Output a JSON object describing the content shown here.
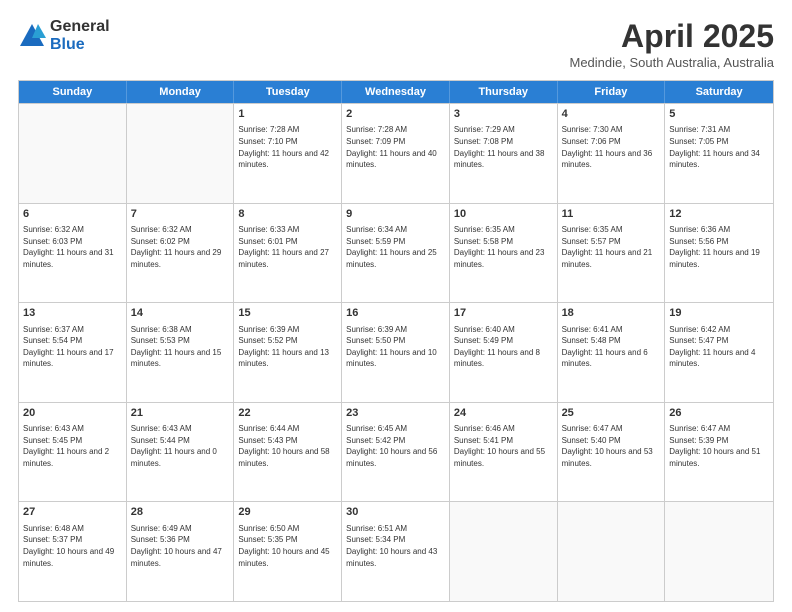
{
  "logo": {
    "general": "General",
    "blue": "Blue"
  },
  "header": {
    "month_year": "April 2025",
    "location": "Medindie, South Australia, Australia"
  },
  "days_of_week": [
    "Sunday",
    "Monday",
    "Tuesday",
    "Wednesday",
    "Thursday",
    "Friday",
    "Saturday"
  ],
  "rows": [
    [
      {
        "day": "",
        "info": ""
      },
      {
        "day": "",
        "info": ""
      },
      {
        "day": "1",
        "info": "Sunrise: 7:28 AM\nSunset: 7:10 PM\nDaylight: 11 hours and 42 minutes."
      },
      {
        "day": "2",
        "info": "Sunrise: 7:28 AM\nSunset: 7:09 PM\nDaylight: 11 hours and 40 minutes."
      },
      {
        "day": "3",
        "info": "Sunrise: 7:29 AM\nSunset: 7:08 PM\nDaylight: 11 hours and 38 minutes."
      },
      {
        "day": "4",
        "info": "Sunrise: 7:30 AM\nSunset: 7:06 PM\nDaylight: 11 hours and 36 minutes."
      },
      {
        "day": "5",
        "info": "Sunrise: 7:31 AM\nSunset: 7:05 PM\nDaylight: 11 hours and 34 minutes."
      }
    ],
    [
      {
        "day": "6",
        "info": "Sunrise: 6:32 AM\nSunset: 6:03 PM\nDaylight: 11 hours and 31 minutes."
      },
      {
        "day": "7",
        "info": "Sunrise: 6:32 AM\nSunset: 6:02 PM\nDaylight: 11 hours and 29 minutes."
      },
      {
        "day": "8",
        "info": "Sunrise: 6:33 AM\nSunset: 6:01 PM\nDaylight: 11 hours and 27 minutes."
      },
      {
        "day": "9",
        "info": "Sunrise: 6:34 AM\nSunset: 5:59 PM\nDaylight: 11 hours and 25 minutes."
      },
      {
        "day": "10",
        "info": "Sunrise: 6:35 AM\nSunset: 5:58 PM\nDaylight: 11 hours and 23 minutes."
      },
      {
        "day": "11",
        "info": "Sunrise: 6:35 AM\nSunset: 5:57 PM\nDaylight: 11 hours and 21 minutes."
      },
      {
        "day": "12",
        "info": "Sunrise: 6:36 AM\nSunset: 5:56 PM\nDaylight: 11 hours and 19 minutes."
      }
    ],
    [
      {
        "day": "13",
        "info": "Sunrise: 6:37 AM\nSunset: 5:54 PM\nDaylight: 11 hours and 17 minutes."
      },
      {
        "day": "14",
        "info": "Sunrise: 6:38 AM\nSunset: 5:53 PM\nDaylight: 11 hours and 15 minutes."
      },
      {
        "day": "15",
        "info": "Sunrise: 6:39 AM\nSunset: 5:52 PM\nDaylight: 11 hours and 13 minutes."
      },
      {
        "day": "16",
        "info": "Sunrise: 6:39 AM\nSunset: 5:50 PM\nDaylight: 11 hours and 10 minutes."
      },
      {
        "day": "17",
        "info": "Sunrise: 6:40 AM\nSunset: 5:49 PM\nDaylight: 11 hours and 8 minutes."
      },
      {
        "day": "18",
        "info": "Sunrise: 6:41 AM\nSunset: 5:48 PM\nDaylight: 11 hours and 6 minutes."
      },
      {
        "day": "19",
        "info": "Sunrise: 6:42 AM\nSunset: 5:47 PM\nDaylight: 11 hours and 4 minutes."
      }
    ],
    [
      {
        "day": "20",
        "info": "Sunrise: 6:43 AM\nSunset: 5:45 PM\nDaylight: 11 hours and 2 minutes."
      },
      {
        "day": "21",
        "info": "Sunrise: 6:43 AM\nSunset: 5:44 PM\nDaylight: 11 hours and 0 minutes."
      },
      {
        "day": "22",
        "info": "Sunrise: 6:44 AM\nSunset: 5:43 PM\nDaylight: 10 hours and 58 minutes."
      },
      {
        "day": "23",
        "info": "Sunrise: 6:45 AM\nSunset: 5:42 PM\nDaylight: 10 hours and 56 minutes."
      },
      {
        "day": "24",
        "info": "Sunrise: 6:46 AM\nSunset: 5:41 PM\nDaylight: 10 hours and 55 minutes."
      },
      {
        "day": "25",
        "info": "Sunrise: 6:47 AM\nSunset: 5:40 PM\nDaylight: 10 hours and 53 minutes."
      },
      {
        "day": "26",
        "info": "Sunrise: 6:47 AM\nSunset: 5:39 PM\nDaylight: 10 hours and 51 minutes."
      }
    ],
    [
      {
        "day": "27",
        "info": "Sunrise: 6:48 AM\nSunset: 5:37 PM\nDaylight: 10 hours and 49 minutes."
      },
      {
        "day": "28",
        "info": "Sunrise: 6:49 AM\nSunset: 5:36 PM\nDaylight: 10 hours and 47 minutes."
      },
      {
        "day": "29",
        "info": "Sunrise: 6:50 AM\nSunset: 5:35 PM\nDaylight: 10 hours and 45 minutes."
      },
      {
        "day": "30",
        "info": "Sunrise: 6:51 AM\nSunset: 5:34 PM\nDaylight: 10 hours and 43 minutes."
      },
      {
        "day": "",
        "info": ""
      },
      {
        "day": "",
        "info": ""
      },
      {
        "day": "",
        "info": ""
      }
    ]
  ]
}
